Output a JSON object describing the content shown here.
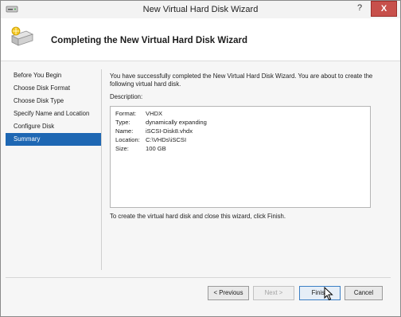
{
  "window": {
    "title": "New Virtual Hard Disk Wizard",
    "help_label": "?",
    "close_label": "X"
  },
  "header": {
    "title": "Completing the New Virtual Hard Disk Wizard"
  },
  "steps": [
    {
      "label": "Before You Begin",
      "active": false
    },
    {
      "label": "Choose Disk Format",
      "active": false
    },
    {
      "label": "Choose Disk Type",
      "active": false
    },
    {
      "label": "Specify Name and Location",
      "active": false
    },
    {
      "label": "Configure Disk",
      "active": false
    },
    {
      "label": "Summary",
      "active": true
    }
  ],
  "content": {
    "intro": "You have successfully completed the New Virtual Hard Disk Wizard. You are about to create the following virtual hard disk.",
    "description_label": "Description:",
    "details": [
      {
        "key": "Format:",
        "value": "VHDX"
      },
      {
        "key": "Type:",
        "value": "dynamically expanding"
      },
      {
        "key": "Name:",
        "value": "iSCSI-Disk8.vhdx"
      },
      {
        "key": "Location:",
        "value": "C:\\VHDs\\iSCSI"
      },
      {
        "key": "Size:",
        "value": "100 GB"
      }
    ],
    "finish_note": "To create the virtual hard disk and close this wizard, click Finish."
  },
  "buttons": {
    "previous": "< Previous",
    "next": "Next >",
    "finish": "Finish",
    "cancel": "Cancel"
  },
  "colors": {
    "active_step": "#1e67b3",
    "close_button": "#c7504b"
  }
}
